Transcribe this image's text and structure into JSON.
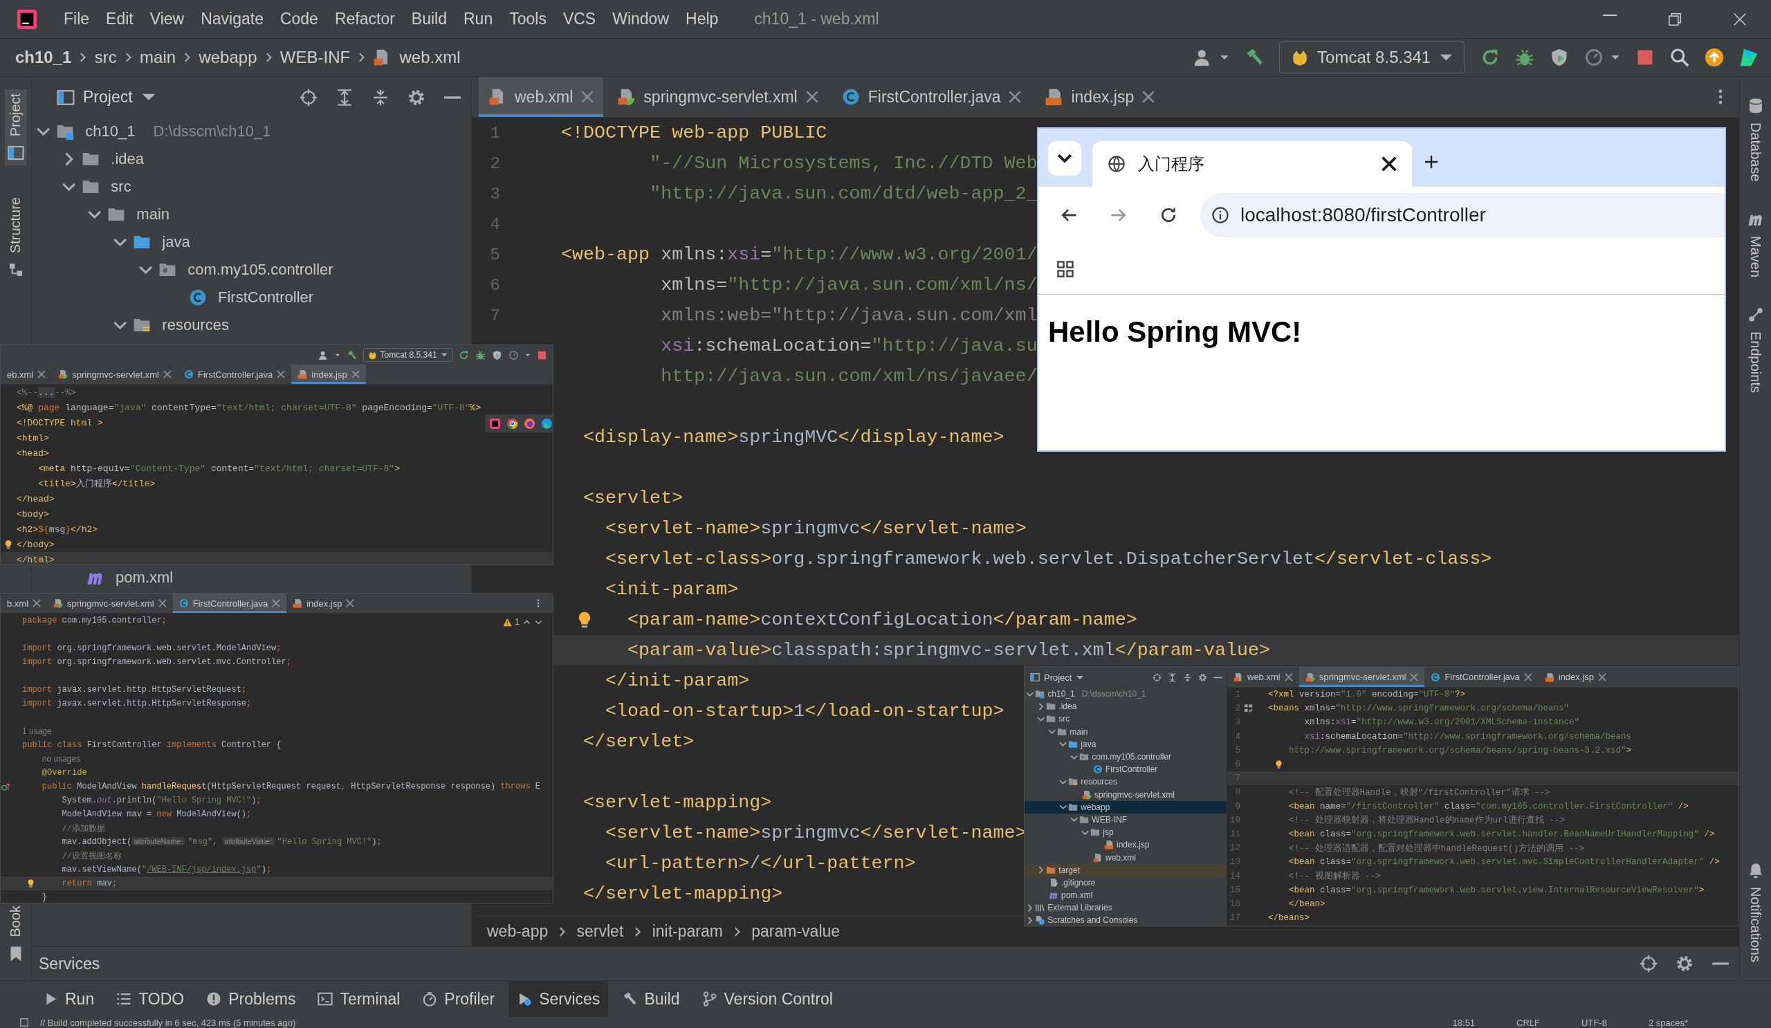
{
  "title_bar": {
    "menus": [
      "File",
      "Edit",
      "View",
      "Navigate",
      "Code",
      "Refactor",
      "Build",
      "Run",
      "Tools",
      "VCS",
      "Window",
      "Help"
    ],
    "title": "ch10_1 - web.xml"
  },
  "nav_bar": {
    "breadcrumbs": [
      {
        "label": "ch10_1"
      },
      {
        "label": "src"
      },
      {
        "label": "main"
      },
      {
        "label": "webapp"
      },
      {
        "label": "WEB-INF"
      },
      {
        "label": "web.xml",
        "kind": "xml"
      }
    ],
    "run_config": "Tomcat 8.5.341"
  },
  "left_strip": [
    {
      "label": "Project",
      "kind": "project",
      "selected": true
    },
    {
      "label": "Structure",
      "kind": "structure",
      "selected": false
    },
    {
      "label": "Book",
      "kind": "bookmark",
      "selected": false
    }
  ],
  "project": {
    "title": "Project",
    "tree": [
      {
        "label": "ch10_1",
        "note": "D:\\dsscm\\ch10_1",
        "kind": "module",
        "expanded": true,
        "children": [
          {
            "label": ".idea",
            "kind": "folder",
            "expanded": false
          },
          {
            "label": "src",
            "kind": "folder",
            "expanded": true,
            "children": [
              {
                "label": "main",
                "kind": "folder",
                "expanded": true,
                "children": [
                  {
                    "label": "java",
                    "kind": "srcfolder",
                    "expanded": true,
                    "children": [
                      {
                        "label": "com.my105.controller",
                        "kind": "package",
                        "expanded": true,
                        "children": [
                          {
                            "label": "FirstController",
                            "kind": "class"
                          }
                        ]
                      }
                    ]
                  },
                  {
                    "label": "resources",
                    "kind": "resfolder",
                    "expanded": true
                  }
                ]
              }
            ]
          }
        ]
      }
    ],
    "tree_tail": [
      {
        "label": "pom.xml",
        "kind": "maven"
      }
    ]
  },
  "editor": {
    "tabs": [
      {
        "label": "web.xml",
        "kind": "xml",
        "selected": true
      },
      {
        "label": "springmvc-servlet.xml",
        "kind": "springxml",
        "selected": false
      },
      {
        "label": "FirstController.java",
        "kind": "class",
        "selected": false
      },
      {
        "label": "index.jsp",
        "kind": "jsp",
        "selected": false
      }
    ],
    "lines": [
      {
        "n": "1",
        "current": false,
        "segs": [
          {
            "kind": "tag",
            "text": "<!DOCTYPE web-app PUBLIC"
          }
        ]
      },
      {
        "n": "2",
        "current": false,
        "segs": [
          {
            "kind": "str",
            "text": "        \"-//Sun Microsystems, Inc.//DTD Web"
          }
        ]
      },
      {
        "n": "3",
        "current": false,
        "segs": [
          {
            "kind": "str",
            "text": "        \"http://java.sun.com/dtd/web-app_2_"
          }
        ]
      },
      {
        "n": "4",
        "current": false
      },
      {
        "n": "5",
        "current": false,
        "segs": [
          {
            "kind": "tag",
            "text": "<web-app "
          },
          {
            "kind": "attr",
            "text": "xmlns:"
          },
          {
            "kind": "ns",
            "text": "xsi"
          },
          {
            "kind": "attr",
            "text": "="
          },
          {
            "kind": "str",
            "text": "\"http://www.w3.org/2001/"
          }
        ]
      },
      {
        "n": "6",
        "current": false,
        "segs": [
          {
            "kind": "attr",
            "text": "         xmlns="
          },
          {
            "kind": "str",
            "text": "\"http://java.sun.com/xml/ns/"
          }
        ]
      },
      {
        "n": "7",
        "current": false,
        "segs": [
          {
            "kind": "comment",
            "text": "         xmlns:web=\"http://java.sun.com/xml"
          }
        ]
      },
      {
        "current": false,
        "segs": [
          {
            "kind": "ns",
            "text": "         xsi"
          },
          {
            "kind": "attr",
            "text": ":schemaLocation="
          },
          {
            "kind": "str",
            "text": "\"http://java.su"
          }
        ]
      },
      {
        "current": false,
        "segs": [
          {
            "kind": "str",
            "text": "         http://java.sun.com/xml/ns/javaee/"
          }
        ]
      },
      {
        "current": false
      },
      {
        "current": false,
        "segs": [
          {
            "kind": "tag",
            "text": "  <display-name>"
          },
          {
            "kind": "plain",
            "text": "springMVC"
          },
          {
            "kind": "tag",
            "text": "</display-name>"
          }
        ]
      },
      {
        "current": false
      },
      {
        "current": false,
        "segs": [
          {
            "kind": "tag",
            "text": "  <servlet>"
          }
        ]
      },
      {
        "current": false,
        "segs": [
          {
            "kind": "tag",
            "text": "    <servlet-name>"
          },
          {
            "kind": "plain",
            "text": "springmvc"
          },
          {
            "kind": "tag",
            "text": "</servlet-name>"
          }
        ]
      },
      {
        "current": false,
        "segs": [
          {
            "kind": "tag",
            "text": "    <servlet-class>"
          },
          {
            "kind": "plain",
            "text": "org.springframework.web.servlet.DispatcherServlet"
          },
          {
            "kind": "tag",
            "text": "</servlet-class>"
          }
        ]
      },
      {
        "current": false,
        "segs": [
          {
            "kind": "tag",
            "text": "    <init-param>"
          }
        ]
      },
      {
        "current": false,
        "kind": "bulb",
        "segs": [
          {
            "kind": "tag",
            "text": "      <param-name>"
          },
          {
            "kind": "plain",
            "text": "contextConfigLocation"
          },
          {
            "kind": "tag",
            "text": "</param-name>"
          }
        ]
      },
      {
        "current": true,
        "segs": [
          {
            "kind": "tag",
            "text": "      <param-value>"
          },
          {
            "kind": "plain",
            "text": "classpath:springmvc-servlet.xml"
          },
          {
            "kind": "tag",
            "text": "</param-value>"
          }
        ]
      },
      {
        "current": false,
        "segs": [
          {
            "kind": "tag",
            "text": "    </init-param>"
          }
        ]
      },
      {
        "current": false,
        "segs": [
          {
            "kind": "tag",
            "text": "    <load-on-startup>"
          },
          {
            "kind": "plain",
            "text": "1"
          },
          {
            "kind": "tag",
            "text": "</load-on-startup>"
          }
        ]
      },
      {
        "current": false,
        "segs": [
          {
            "kind": "tag",
            "text": "  </servlet>"
          }
        ]
      },
      {
        "current": false
      },
      {
        "current": false,
        "segs": [
          {
            "kind": "tag",
            "text": "  <servlet-mapping>"
          }
        ]
      },
      {
        "current": false,
        "segs": [
          {
            "kind": "tag",
            "text": "    <servlet-name>"
          },
          {
            "kind": "plain",
            "text": "springmvc"
          },
          {
            "kind": "tag",
            "text": "</servlet-name>"
          }
        ]
      },
      {
        "current": false,
        "segs": [
          {
            "kind": "tag",
            "text": "    <url-pattern>"
          },
          {
            "kind": "plain",
            "text": "/"
          },
          {
            "kind": "tag",
            "text": "</url-pattern>"
          }
        ]
      },
      {
        "current": false,
        "segs": [
          {
            "kind": "tag",
            "text": "  </servlet-mapping>"
          }
        ]
      }
    ],
    "breadcrumbs": [
      "web-app",
      "servlet",
      "init-param",
      "param-value"
    ]
  },
  "browser": {
    "tab_title": "入门程序",
    "url": "localhost:8080/firstController",
    "heading": "Hello Spring MVC!"
  },
  "inset_jsp": {
    "run_config": "Tomcat 8.5.341",
    "tabs": [
      {
        "label": "eb.xml",
        "kind": "cut",
        "selected": false
      },
      {
        "label": "springmvc-servlet.xml",
        "kind": "springxml",
        "selected": false
      },
      {
        "label": "FirstController.java",
        "kind": "class",
        "selected": false
      },
      {
        "label": "index.jsp",
        "kind": "jsp",
        "selected": true
      }
    ],
    "lines": [
      {
        "current": false,
        "segs": [
          {
            "kind": "comment",
            "text": "<%--"
          },
          {
            "kind": "fold",
            "text": "..."
          },
          {
            "kind": "comment",
            "text": "--%>"
          }
        ]
      },
      {
        "current": false,
        "segs": [
          {
            "kind": "tag",
            "text": "<%@ "
          },
          {
            "kind": "kw",
            "text": "page "
          },
          {
            "kind": "attr",
            "text": "language="
          },
          {
            "kind": "str",
            "text": "\"java\" "
          },
          {
            "kind": "attr",
            "text": "contentType="
          },
          {
            "kind": "str",
            "text": "\"text/html; charset=UTF-8\" "
          },
          {
            "kind": "attr",
            "text": "pageEncoding="
          },
          {
            "kind": "str",
            "text": "\"UTF-8\""
          },
          {
            "kind": "tag",
            "text": "%>"
          }
        ]
      },
      {
        "current": false,
        "segs": [
          {
            "kind": "tag",
            "text": "<!DOCTYPE html >"
          }
        ]
      },
      {
        "current": false,
        "segs": [
          {
            "kind": "tag",
            "text": "<html>"
          }
        ]
      },
      {
        "current": false,
        "segs": [
          {
            "kind": "tag",
            "text": "<head>"
          }
        ]
      },
      {
        "current": false,
        "segs": [
          {
            "kind": "tag",
            "text": "    <meta "
          },
          {
            "kind": "attr",
            "text": "http-equiv="
          },
          {
            "kind": "str",
            "text": "\"Content-Type\" "
          },
          {
            "kind": "attr",
            "text": "content="
          },
          {
            "kind": "str",
            "text": "\"text/html; charset=UTF-8\""
          },
          {
            "kind": "tag",
            "text": ">"
          }
        ]
      },
      {
        "current": false,
        "segs": [
          {
            "kind": "tag",
            "text": "    <title>"
          },
          {
            "kind": "plain",
            "text": "入门程序"
          },
          {
            "kind": "tag",
            "text": "</title>"
          }
        ]
      },
      {
        "current": false,
        "segs": [
          {
            "kind": "tag",
            "text": "</head>"
          }
        ]
      },
      {
        "current": false,
        "segs": [
          {
            "kind": "tag",
            "text": "<body>"
          }
        ]
      },
      {
        "current": false,
        "segs": [
          {
            "kind": "tag",
            "text": "<h2>"
          },
          {
            "kind": "kw",
            "text": "${"
          },
          {
            "kind": "plain",
            "text": "msg"
          },
          {
            "kind": "kw",
            "text": "}"
          },
          {
            "kind": "tag",
            "text": "</h2>"
          }
        ]
      },
      {
        "current": false,
        "kind": "bulb",
        "segs": [
          {
            "kind": "tag",
            "text": "</body>"
          }
        ]
      },
      {
        "current": true,
        "segs": [
          {
            "kind": "tag",
            "text": "</html>"
          }
        ]
      }
    ]
  },
  "inset_java": {
    "tabs": [
      {
        "label": "b.xml",
        "kind": "cut",
        "selected": false
      },
      {
        "label": "springmvc-servlet.xml",
        "kind": "springxml",
        "selected": false
      },
      {
        "label": "FirstController.java",
        "kind": "class",
        "selected": true
      },
      {
        "label": "index.jsp",
        "kind": "jsp",
        "selected": false
      }
    ],
    "warning_count": "1",
    "lines": [
      {
        "current": false,
        "segs": [
          {
            "kind": "kw",
            "text": "package "
          },
          {
            "kind": "plain",
            "text": "com.my105.controller"
          },
          {
            "kind": "kw",
            "text": ";"
          }
        ]
      },
      {
        "current": false
      },
      {
        "current": false,
        "segs": [
          {
            "kind": "kw",
            "text": "import "
          },
          {
            "kind": "plain",
            "text": "org.springframework.web.servlet.ModelAndView"
          },
          {
            "kind": "kw",
            "text": ";"
          }
        ]
      },
      {
        "current": false,
        "segs": [
          {
            "kind": "kw",
            "text": "import "
          },
          {
            "kind": "plain",
            "text": "org.springframework.web.servlet.mvc.Controller"
          },
          {
            "kind": "kw",
            "text": ";"
          }
        ]
      },
      {
        "current": false
      },
      {
        "current": false,
        "segs": [
          {
            "kind": "kw",
            "text": "import "
          },
          {
            "kind": "plain",
            "text": "javax.servlet.http.HttpServletRequest"
          },
          {
            "kind": "kw",
            "text": ";"
          }
        ]
      },
      {
        "current": false,
        "segs": [
          {
            "kind": "kw",
            "text": "import "
          },
          {
            "kind": "plain",
            "text": "javax.servlet.http.HttpServletResponse"
          },
          {
            "kind": "kw",
            "text": ";"
          }
        ]
      },
      {
        "current": false
      },
      {
        "current": false,
        "segs": [
          {
            "kind": "usage",
            "text": "1 usage"
          }
        ]
      },
      {
        "current": false,
        "segs": [
          {
            "kind": "kw",
            "text": "public class "
          },
          {
            "kind": "plain",
            "text": "FirstController "
          },
          {
            "kind": "kw",
            "text": "implements "
          },
          {
            "kind": "plain",
            "text": "Controller {"
          }
        ]
      },
      {
        "current": false,
        "segs": [
          {
            "kind": "usage",
            "text": "    no usages"
          }
        ]
      },
      {
        "current": false,
        "segs": [
          {
            "kind": "annot",
            "text": "    @Override"
          }
        ]
      },
      {
        "current": false,
        "kind": "override",
        "segs": [
          {
            "kind": "kw",
            "text": "    public "
          },
          {
            "kind": "plain",
            "text": "ModelAndView "
          },
          {
            "kind": "method",
            "text": "handleRequest"
          },
          {
            "kind": "plain",
            "text": "(HttpServletRequest request"
          },
          {
            "kind": "kw",
            "text": ", "
          },
          {
            "kind": "plain",
            "text": "HttpServletResponse response) "
          },
          {
            "kind": "kw",
            "text": "throws "
          },
          {
            "kind": "plain",
            "text": "E"
          }
        ]
      },
      {
        "current": false,
        "segs": [
          {
            "kind": "plain",
            "text": "        System."
          },
          {
            "kind": "field",
            "text": "out"
          },
          {
            "kind": "plain",
            "text": ".println("
          },
          {
            "kind": "str",
            "text": "\"Hello Spring MVC!\""
          },
          {
            "kind": "plain",
            "text": ")"
          },
          {
            "kind": "kw",
            "text": ";"
          }
        ]
      },
      {
        "current": false,
        "segs": [
          {
            "kind": "plain",
            "text": "        ModelAndView mav = "
          },
          {
            "kind": "kw",
            "text": "new "
          },
          {
            "kind": "plain",
            "text": "ModelAndView()"
          },
          {
            "kind": "kw",
            "text": ";"
          }
        ]
      },
      {
        "current": false,
        "segs": [
          {
            "kind": "comment",
            "text": "        //添加数据"
          }
        ]
      },
      {
        "current": false,
        "segs": [
          {
            "kind": "plain",
            "text": "        mav.addObject("
          },
          {
            "kind": "hint",
            "text": "attributeName:"
          },
          {
            "kind": "str",
            "text": "\"msg\""
          },
          {
            "kind": "kw",
            "text": ", "
          },
          {
            "kind": "hint",
            "text": "attributeValue:"
          },
          {
            "kind": "str",
            "text": "\"Hello Spring MVC!\""
          },
          {
            "kind": "plain",
            "text": ")"
          },
          {
            "kind": "kw",
            "text": ";"
          }
        ]
      },
      {
        "current": false,
        "segs": [
          {
            "kind": "comment",
            "text": "        //设置视图名称"
          }
        ]
      },
      {
        "current": false,
        "segs": [
          {
            "kind": "plain",
            "text": "        mav.setViewName("
          },
          {
            "kind": "str",
            "text": "\""
          },
          {
            "kind": "link",
            "text": "/WEB-INF/jsp/index.jsp"
          },
          {
            "kind": "str",
            "text": "\""
          },
          {
            "kind": "plain",
            "text": ")"
          },
          {
            "kind": "kw",
            "text": ";"
          }
        ]
      },
      {
        "current": true,
        "kind": "bulb",
        "segs": [
          {
            "kind": "kw",
            "text": "        return "
          },
          {
            "kind": "plain",
            "text": "mav"
          },
          {
            "kind": "kw",
            "text": ";"
          }
        ]
      },
      {
        "current": false,
        "segs": [
          {
            "kind": "plain",
            "text": "    }"
          }
        ]
      }
    ]
  },
  "inset_xml": {
    "panel_title": "Project",
    "tree": [
      {
        "label": "ch10_1",
        "note": "D:\\dsscm\\ch10_1",
        "kind": "module",
        "expanded": true,
        "selected": false,
        "children": [
          {
            "label": ".idea",
            "kind": "folder",
            "expanded": false,
            "selected": false
          },
          {
            "label": "src",
            "kind": "folder",
            "expanded": true,
            "selected": false,
            "children": [
              {
                "label": "main",
                "kind": "folder",
                "expanded": true,
                "selected": false,
                "children": [
                  {
                    "label": "java",
                    "kind": "srcfolder",
                    "expanded": true,
                    "selected": false,
                    "children": [
                      {
                        "label": "com.my105.controller",
                        "kind": "package",
                        "expanded": true,
                        "selected": false,
                        "children": [
                          {
                            "label": "FirstController",
                            "kind": "class",
                            "selected": false
                          }
                        ]
                      }
                    ]
                  },
                  {
                    "label": "resources",
                    "kind": "resfolder",
                    "expanded": true,
                    "selected": false,
                    "children": [
                      {
                        "label": "springmvc-servlet.xml",
                        "kind": "springxml",
                        "selected": false
                      }
                    ]
                  },
                  {
                    "label": "webapp",
                    "kind": "webfolder",
                    "expanded": true,
                    "selected": true,
                    "children": [
                      {
                        "label": "WEB-INF",
                        "kind": "folder",
                        "expanded": true,
                        "selected": false,
                        "children": [
                          {
                            "label": "jsp",
                            "kind": "folder",
                            "expanded": true,
                            "selected": false,
                            "children": [
                              {
                                "label": "index.jsp",
                                "kind": "jsp",
                                "selected": false
                              }
                            ]
                          },
                          {
                            "label": "web.xml",
                            "kind": "xml",
                            "selected": false
                          }
                        ]
                      }
                    ]
                  }
                ]
              }
            ]
          },
          {
            "label": "target",
            "kind": "target",
            "expanded": false,
            "selected": false
          },
          {
            "label": ".gitignore",
            "kind": "git",
            "selected": false
          },
          {
            "label": "pom.xml",
            "kind": "maven",
            "selected": false
          }
        ]
      },
      {
        "label": "External Libraries",
        "kind": "libs",
        "expanded": false,
        "selected": false
      },
      {
        "label": "Scratches and Consoles",
        "kind": "scratch",
        "expanded": false,
        "selected": false
      }
    ],
    "tabs": [
      {
        "label": "web.xml",
        "kind": "xml",
        "selected": false
      },
      {
        "label": "springmvc-servlet.xml",
        "kind": "springxml",
        "selected": true
      },
      {
        "label": "FirstController.java",
        "kind": "class",
        "selected": false
      },
      {
        "label": "index.jsp",
        "kind": "jsp",
        "selected": false
      }
    ],
    "lines": [
      {
        "n": "1",
        "current": false,
        "segs": [
          {
            "kind": "tag",
            "text": "<?xml "
          },
          {
            "kind": "attr",
            "text": "version="
          },
          {
            "kind": "str",
            "text": "\"1.0\" "
          },
          {
            "kind": "attr",
            "text": "encoding="
          },
          {
            "kind": "str",
            "text": "\"UTF-8\""
          },
          {
            "kind": "tag",
            "text": "?>"
          }
        ]
      },
      {
        "n": "2",
        "current": false,
        "kind": "bean",
        "segs": [
          {
            "kind": "tag",
            "text": "<beans "
          },
          {
            "kind": "attr",
            "text": "xmlns="
          },
          {
            "kind": "str",
            "text": "\"http://www.springframework.org/schema/beans\""
          }
        ]
      },
      {
        "n": "3",
        "current": false,
        "segs": [
          {
            "kind": "attr",
            "text": "       xmlns:"
          },
          {
            "kind": "ns",
            "text": "xsi"
          },
          {
            "kind": "attr",
            "text": "="
          },
          {
            "kind": "str",
            "text": "\"http://www.w3.org/2001/XMLSchema-instance\""
          }
        ]
      },
      {
        "n": "4",
        "current": false,
        "segs": [
          {
            "kind": "ns",
            "text": "       xsi"
          },
          {
            "kind": "attr",
            "text": ":schemaLocation="
          },
          {
            "kind": "str",
            "text": "\"http://www.springframework.org/schema/beans"
          }
        ]
      },
      {
        "n": "5",
        "current": false,
        "segs": [
          {
            "kind": "str",
            "text": "    http://www.springframework.org/schema/beans/spring-beans-3.2.xsd\""
          },
          {
            "kind": "tag",
            "text": ">"
          }
        ]
      },
      {
        "n": "6",
        "current": false,
        "kind": "bulb"
      },
      {
        "n": "7",
        "current": true
      },
      {
        "n": "8",
        "current": false,
        "segs": [
          {
            "kind": "comment",
            "text": "    <!-- 配置处理器Handle，映射“/firstController”请求 -->"
          }
        ]
      },
      {
        "n": "9",
        "current": false,
        "segs": [
          {
            "kind": "tag",
            "text": "    <bean "
          },
          {
            "kind": "attr",
            "text": "name="
          },
          {
            "kind": "str",
            "text": "\"/firstController\" "
          },
          {
            "kind": "attr",
            "text": "class="
          },
          {
            "kind": "str",
            "text": "\"com.my105.controller.FirstController\" "
          },
          {
            "kind": "tag",
            "text": "/>"
          }
        ]
      },
      {
        "n": "10",
        "current": false,
        "segs": [
          {
            "kind": "comment",
            "text": "    <!-- 处理器映射器，将处理器Handle的name作为url进行查找 -->"
          }
        ]
      },
      {
        "n": "11",
        "current": false,
        "segs": [
          {
            "kind": "tag",
            "text": "    <bean "
          },
          {
            "kind": "attr",
            "text": "class="
          },
          {
            "kind": "str",
            "text": "\"org.springframework.web.servlet.handler.BeanNameUrlHandlerMapping\" "
          },
          {
            "kind": "tag",
            "text": "/>"
          }
        ]
      },
      {
        "n": "12",
        "current": false,
        "segs": [
          {
            "kind": "comment",
            "text": "    <!-- 处理器适配器，配置对处理器中handleRequest()方法的调用 -->"
          }
        ]
      },
      {
        "n": "13",
        "current": false,
        "segs": [
          {
            "kind": "tag",
            "text": "    <bean "
          },
          {
            "kind": "attr",
            "text": "class="
          },
          {
            "kind": "str",
            "text": "\"org.springframework.web.servlet.mvc.SimpleControllerHandlerAdapter\" "
          },
          {
            "kind": "tag",
            "text": "/>"
          }
        ]
      },
      {
        "n": "14",
        "current": false,
        "segs": [
          {
            "kind": "comment",
            "text": "    <!-- 视图解析器 -->"
          }
        ]
      },
      {
        "n": "15",
        "current": false,
        "segs": [
          {
            "kind": "tag",
            "text": "    <bean "
          },
          {
            "kind": "attr",
            "text": "class="
          },
          {
            "kind": "str",
            "text": "\"org.springframework.web.servlet.view.InternalResourceViewResolver\""
          },
          {
            "kind": "tag",
            "text": ">"
          }
        ]
      },
      {
        "n": "16",
        "current": false,
        "segs": [
          {
            "kind": "tag",
            "text": "    </bean>"
          }
        ]
      },
      {
        "n": "17",
        "current": false,
        "segs": [
          {
            "kind": "tag",
            "text": "</beans>"
          }
        ]
      }
    ]
  },
  "services": {
    "title": "Services"
  },
  "tool_tabs": [
    {
      "label": "Run",
      "kind": "run",
      "selected": false
    },
    {
      "label": "TODO",
      "kind": "todo",
      "selected": false
    },
    {
      "label": "Problems",
      "kind": "problems",
      "selected": false
    },
    {
      "label": "Terminal",
      "kind": "terminal",
      "selected": false
    },
    {
      "label": "Profiler",
      "kind": "profiler",
      "selected": false
    },
    {
      "label": "Services",
      "kind": "services",
      "selected": true
    },
    {
      "label": "Build",
      "kind": "build",
      "selected": false
    },
    {
      "label": "Version Control",
      "kind": "vcs",
      "selected": false
    }
  ],
  "status_bar": {
    "message": "// Build completed successfully in 6 sec, 423 ms (5 minutes ago)",
    "items": [
      "18:51",
      "CRLF",
      "UTF-8",
      "2 spaces*"
    ]
  },
  "right_strip": [
    {
      "label": "Database",
      "kind": "db"
    },
    {
      "label": "Maven",
      "kind": "maven"
    },
    {
      "label": "Endpoints",
      "kind": "endpoints"
    },
    {
      "label": "Notifications",
      "kind": "bell"
    }
  ]
}
